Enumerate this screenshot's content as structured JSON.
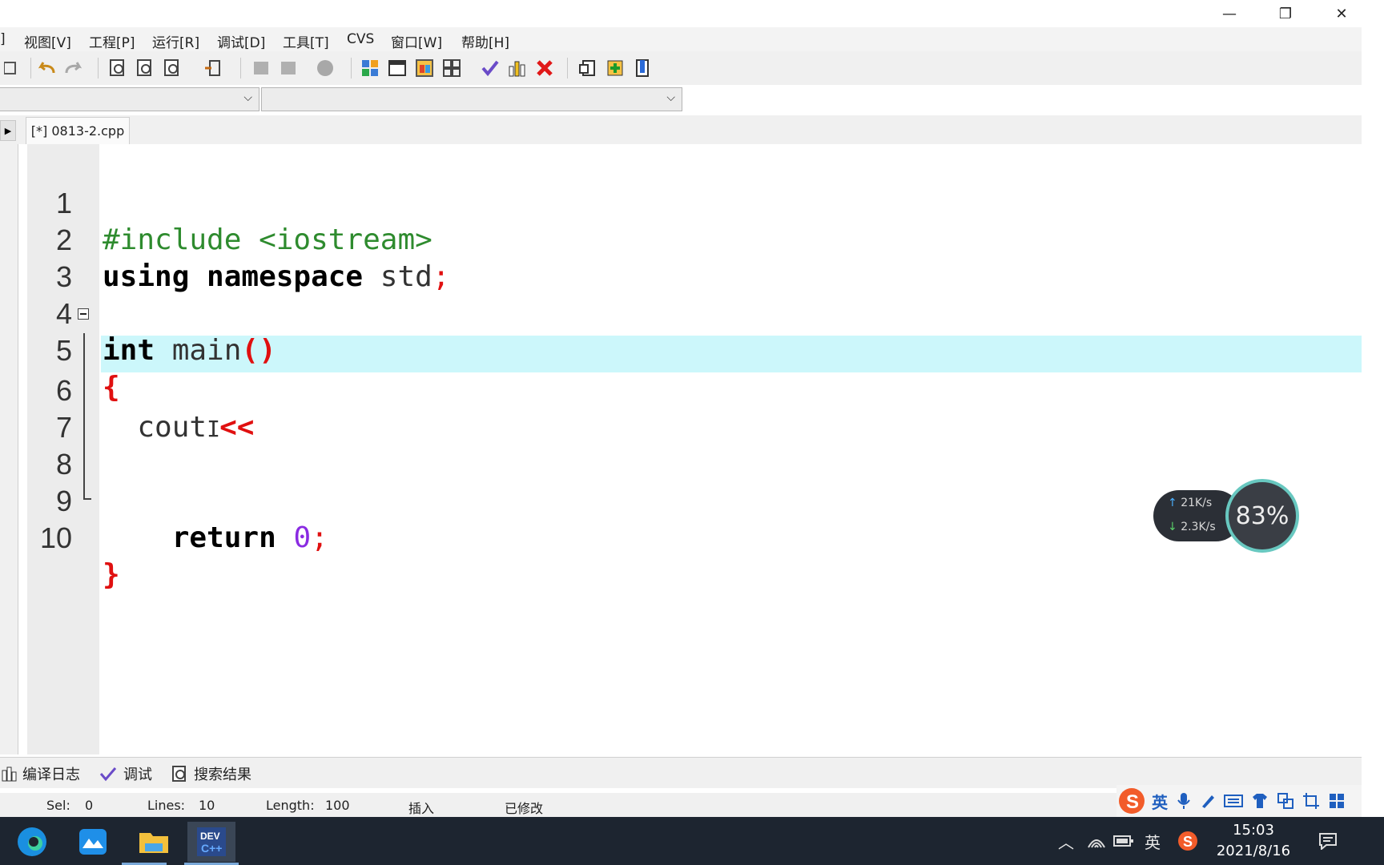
{
  "window": {
    "minimize": "—",
    "restore": "❐",
    "close": "✕"
  },
  "menu": {
    "items": [
      "]",
      "视图[V]",
      "工程[P]",
      "运行[R]",
      "调试[D]",
      "工具[T]",
      "CVS",
      "窗口[W]",
      "帮助[H]"
    ]
  },
  "toolbar": {
    "combo1_value": "",
    "combo2_value": ""
  },
  "editor": {
    "tab_label": "[*] 0813-2.cpp",
    "lines": [
      {
        "num": "1",
        "text": "#include <iostream>"
      },
      {
        "num": "2",
        "kw": "using namespace",
        "rest": " std",
        "sym": ";"
      },
      {
        "num": "3"
      },
      {
        "num": "4",
        "kw": "int",
        "rest": " main",
        "sym": "()"
      },
      {
        "num": "5",
        "sym": "{"
      },
      {
        "num": "6",
        "indent": "  ",
        "rest": "cout",
        "sym": "<<"
      },
      {
        "num": "7"
      },
      {
        "num": "8"
      },
      {
        "num": "9",
        "indent": "    ",
        "kw": "return",
        "num_value": "0",
        "sym": ";"
      },
      {
        "num": "10",
        "sym": "}"
      }
    ],
    "highlighted_line": 6
  },
  "bottom_tabs": {
    "compile_log": "编译日志",
    "debug": "调试",
    "search_results": "搜索结果"
  },
  "status": {
    "sel_label": "Sel:",
    "sel_value": "0",
    "lines_label": "Lines:",
    "lines_value": "10",
    "length_label": "Length:",
    "length_value": "100",
    "mode": "插入",
    "modified": "已修改"
  },
  "net_monitor": {
    "upload": "21K/s",
    "download": "2.3K/s",
    "percent": "83%"
  },
  "ime": {
    "lang": "英"
  },
  "taskbar": {
    "tray_lang": "英",
    "time": "15:03",
    "date": "2021/8/16"
  },
  "colors": {
    "keyword": "#000000",
    "preprocessor": "#2e8b2e",
    "symbol": "#e01010",
    "number": "#8a2be2",
    "highlight": "#ccf7fb"
  }
}
